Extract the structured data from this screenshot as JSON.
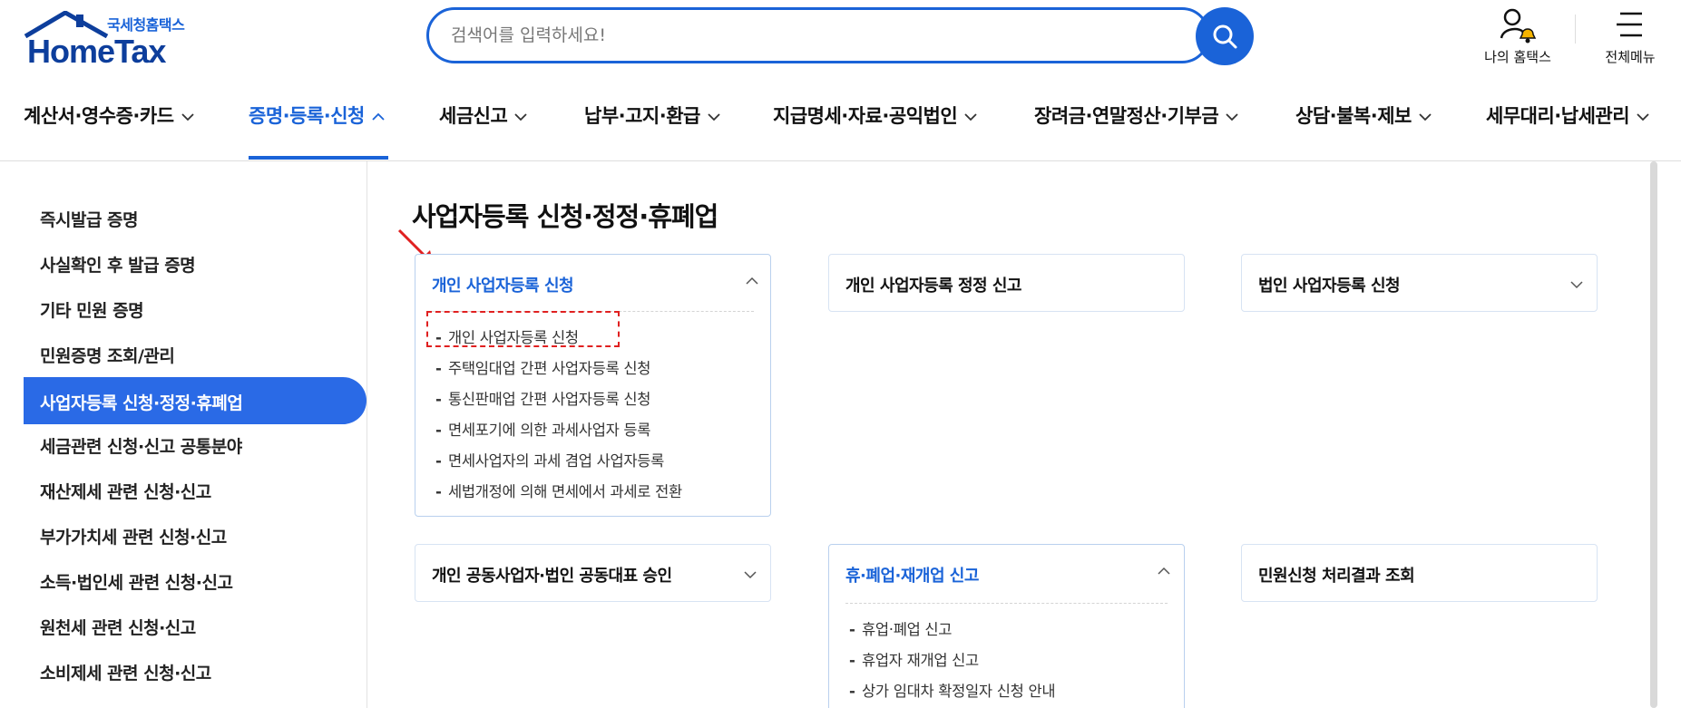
{
  "header": {
    "logo_sub": "국세청홈택스",
    "logo_main": "HomeTax",
    "search_placeholder": "검색어를 입력하세요!",
    "my_hometax_label": "나의 홈택스",
    "all_menu_label": "전체메뉴"
  },
  "nav": {
    "items": [
      {
        "label": "계산서·영수증·카드"
      },
      {
        "label": "증명·등록·신청"
      },
      {
        "label": "세금신고"
      },
      {
        "label": "납부·고지·환급"
      },
      {
        "label": "지급명세·자료·공익법인"
      },
      {
        "label": "장려금·연말정산·기부금"
      },
      {
        "label": "상담·불복·제보"
      },
      {
        "label": "세무대리·납세관리"
      }
    ],
    "active_index": 1
  },
  "sidebar": {
    "items": [
      {
        "label": "즉시발급 증명"
      },
      {
        "label": "사실확인 후 발급 증명"
      },
      {
        "label": "기타 민원 증명"
      },
      {
        "label": "민원증명 조회/관리"
      },
      {
        "label": "사업자등록 신청·정정·휴폐업"
      },
      {
        "label": "세금관련 신청·신고 공통분야"
      },
      {
        "label": "재산제세 관련 신청·신고"
      },
      {
        "label": "부가가치세 관련 신청·신고"
      },
      {
        "label": "소득·법인세 관련 신청·신고"
      },
      {
        "label": "원천세 관련 신청·신고"
      },
      {
        "label": "소비제세 관련 신청·신고"
      }
    ],
    "active_index": 4
  },
  "main": {
    "title": "사업자등록 신청·정정·휴폐업",
    "cards": [
      {
        "title": "개인 사업자등록 신청",
        "expanded": true,
        "items": [
          "개인 사업자등록 신청",
          "주택임대업 간편 사업자등록 신청",
          "통신판매업 간편 사업자등록 신청",
          "면세포기에 의한 과세사업자 등록",
          "면세사업자의 과세 겸업 사업자등록",
          "세법개정에 의해 면세에서 과세로 전환"
        ]
      },
      {
        "title": "개인 사업자등록 정정 신고",
        "expanded": false
      },
      {
        "title": "법인 사업자등록 신청",
        "expanded": false
      },
      {
        "title": "개인 공동사업자·법인 공동대표 승인",
        "expanded": false
      },
      {
        "title": "휴·폐업·재개업 신고",
        "expanded": true,
        "items": [
          "휴업·폐업 신고",
          "휴업자 재개업 신고",
          "상가 임대차 확정일자 신청 안내"
        ]
      },
      {
        "title": "민원신청 처리결과 조회",
        "expanded": false
      }
    ]
  },
  "colors": {
    "accent": "#1a63d8",
    "sidebar_active_bg": "#2a6ae6",
    "highlight": "#e02020",
    "logo_dark": "#0d3e9c"
  },
  "icons": [
    "search-icon",
    "user-bell-icon",
    "hamburger-icon",
    "chevron-down-icon",
    "chevron-up-icon",
    "red-arrow-annotation"
  ]
}
